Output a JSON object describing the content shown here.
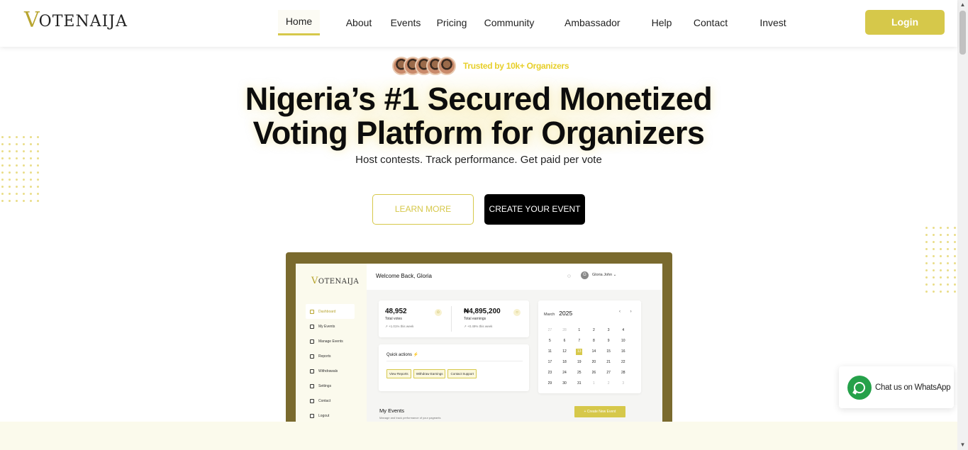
{
  "header": {
    "logo_v": "V",
    "logo_rest": "OTENAIJA",
    "nav": [
      "Home",
      "About",
      "Events",
      "Pricing",
      "Community",
      "Ambassador",
      "Help",
      "Contact",
      "Invest"
    ],
    "login_label": "Login"
  },
  "hero": {
    "trusted_text": "Trusted by 10k+ Organizers",
    "headline_line1": "Nigeria’s #1 Secured Monetized",
    "headline_line2": "Voting Platform for Organizers",
    "subline": "Host contests. Track performance. Get paid per vote",
    "learn_more": "LEARN MORE",
    "create_event": "CREATE YOUR EVENT"
  },
  "mockup": {
    "logo_v": "V",
    "logo_rest": "OTENAIJA",
    "menu": [
      "Dashboard",
      "My Events",
      "Manage Events",
      "Reports",
      "Withdrawals",
      "Settings",
      "Contact",
      "Logout"
    ],
    "welcome": "Welcome Back, Gloria",
    "user_initial": "G",
    "user_name": "Gloria John",
    "stats": [
      {
        "value": "48,952",
        "label": "Total votes",
        "change": "+1.01% this week"
      },
      {
        "value": "₦4,895,200",
        "label": "Total earnings",
        "change": "+0.49% this week"
      }
    ],
    "quick_title": "Quick actions",
    "quick_buttons": [
      "View Reports",
      "Withdraw Earnings",
      "Contact Support"
    ],
    "cal_month": "March",
    "cal_year": "2025",
    "cal_nav": "‹ ›",
    "cal_days": [
      "27",
      "28",
      "1",
      "2",
      "3",
      "4",
      "5",
      "6",
      "7",
      "8",
      "9",
      "10",
      "11",
      "12",
      "13",
      "14",
      "15",
      "16",
      "17",
      "18",
      "19",
      "20",
      "21",
      "22",
      "23",
      "24",
      "25",
      "26",
      "27",
      "28",
      "29",
      "30",
      "31",
      "1",
      "2",
      "3"
    ],
    "cal_selected_index": 14,
    "events_title": "My Events",
    "events_sub": "Manage and track performance of your pageants",
    "new_event": "+ Create New Event"
  },
  "whatsapp": {
    "label": "Chat us on WhatsApp"
  },
  "colors": {
    "accent": "#d6c84a",
    "mock_frame": "#7a6a2e",
    "whatsapp": "#25a14a"
  }
}
